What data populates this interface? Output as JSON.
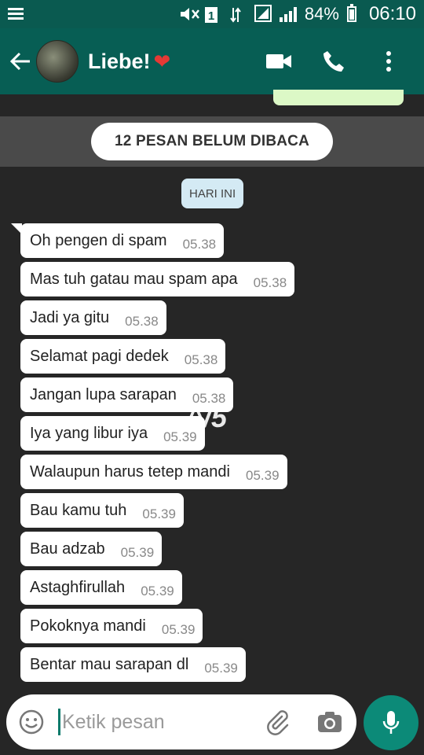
{
  "status_bar": {
    "battery_percent": "84%",
    "time": "06:10",
    "icons": [
      "menu-icon",
      "mute-icon",
      "sim-icon",
      "data-icon",
      "signal-icon",
      "signal-icon",
      "battery-icon"
    ]
  },
  "header": {
    "contact_name": "Liebe!",
    "heart": "❤",
    "icons": [
      "back-arrow-icon",
      "video-call-icon",
      "phone-icon",
      "more-vert-icon"
    ]
  },
  "chat": {
    "unread_banner": "12 PESAN BELUM DIBACA",
    "date_chip": "HARI INI",
    "overlay": "^/5",
    "messages": [
      {
        "text": "Oh pengen di spam",
        "time": "05.38"
      },
      {
        "text": "Mas tuh gatau mau spam apa",
        "time": "05.38"
      },
      {
        "text": "Jadi ya gitu",
        "time": "05.38"
      },
      {
        "text": "Selamat pagi dedek",
        "time": "05.38"
      },
      {
        "text": "Jangan lupa sarapan",
        "time": "05.38"
      },
      {
        "text": "Iya yang libur iya",
        "time": "05.39"
      },
      {
        "text": "Walaupun harus tetep mandi",
        "time": "05.39"
      },
      {
        "text": "Bau kamu tuh",
        "time": "05.39"
      },
      {
        "text": "Bau adzab",
        "time": "05.39"
      },
      {
        "text": "Astaghfirullah",
        "time": "05.39"
      },
      {
        "text": "Pokoknya mandi",
        "time": "05.39"
      },
      {
        "text": "Bentar mau sarapan dl",
        "time": "05.39"
      }
    ]
  },
  "composer": {
    "placeholder": "Ketik pesan",
    "icons": [
      "emoji-icon",
      "attach-icon",
      "camera-icon",
      "mic-icon"
    ]
  },
  "colors": {
    "header": "#075e54",
    "status_bar": "#0a5a50",
    "mic_button": "#0c8a78",
    "chat_bg": "#262626"
  }
}
